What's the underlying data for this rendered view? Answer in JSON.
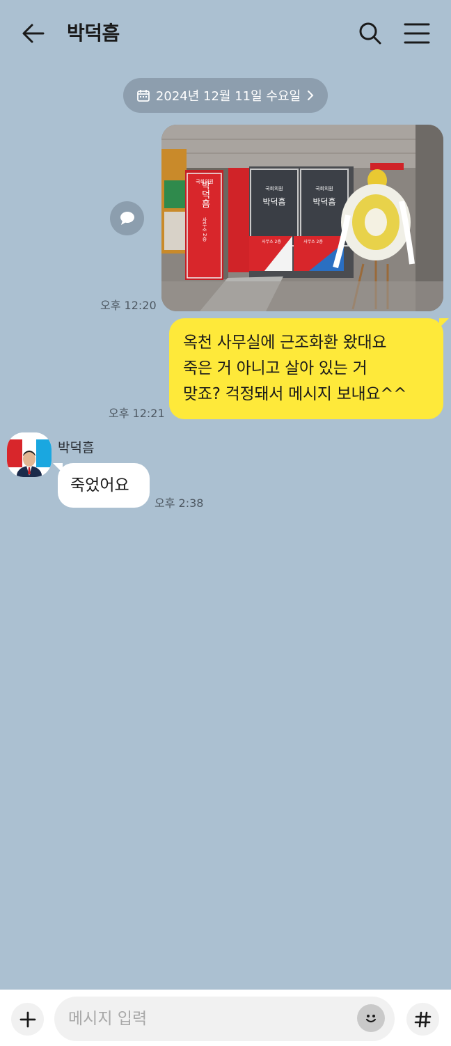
{
  "header": {
    "title": "박덕흠"
  },
  "date_divider": {
    "label": "2024년 12월 11일 수요일"
  },
  "messages": [
    {
      "sender": "me",
      "type": "photo",
      "time": "오후 12:20",
      "photo_texts": {
        "sign_top": "국회의원",
        "sign_name": "박덕흠",
        "sign_sub": "사무소 2층",
        "window_1_top": "국회의원",
        "window_1_name": "박덕흠",
        "window_2_top": "국회의원",
        "window_2_name": "박덕흠",
        "floor_1": "사무소 2층",
        "floor_2": "사무소 2층"
      }
    },
    {
      "sender": "me",
      "type": "text",
      "time": "오후 12:21",
      "lines": [
        "옥천 사무실에 근조화환 왔대요",
        "죽은 거 아니고 살아 있는 거",
        "맞죠? 걱정돼서 메시지 보내요^^"
      ]
    },
    {
      "sender": "other",
      "type": "text",
      "name": "박덕흠",
      "time": "오후 2:38",
      "text": "죽었어요"
    }
  ],
  "composer": {
    "placeholder": "메시지 입력"
  },
  "icons": {
    "back": "arrow-left-icon",
    "search": "search-icon",
    "menu": "hamburger-menu-icon",
    "calendar": "calendar-icon",
    "chevron": "chevron-right-icon",
    "share": "speech-bubble-icon",
    "plus": "plus-icon",
    "emoji": "emoji-icon",
    "hash": "hash-icon"
  },
  "colors": {
    "background": "#abc0d1",
    "my_bubble": "#fee93a",
    "other_bubble": "#ffffff",
    "pill": "#8d9eae"
  }
}
